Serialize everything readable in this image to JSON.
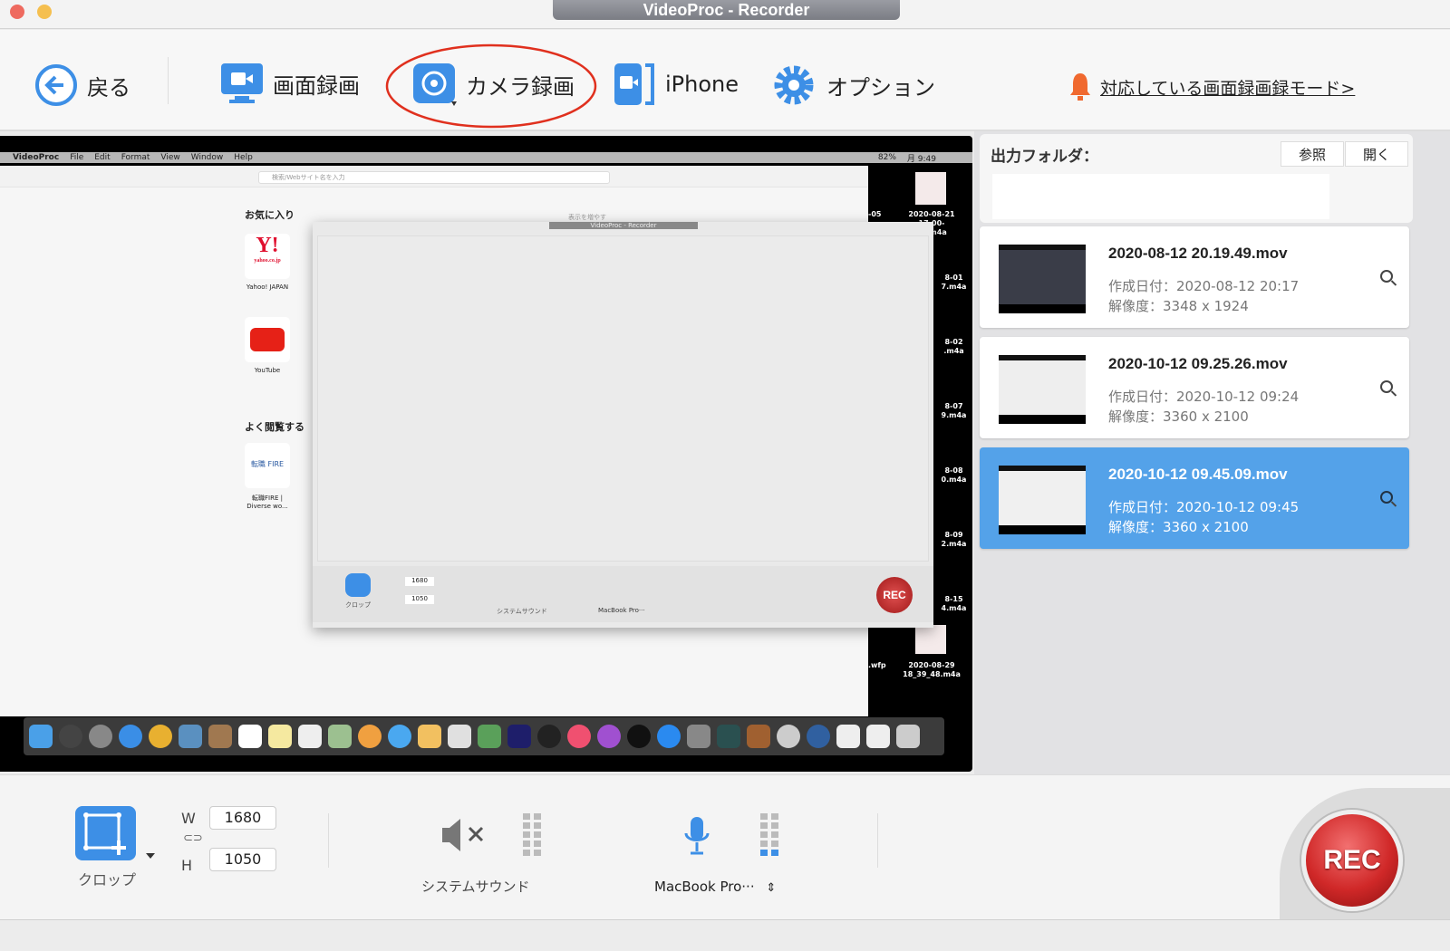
{
  "window": {
    "title": "VideoProc - Recorder"
  },
  "toolbar": {
    "back": "戻る",
    "screen_record": "画面録画",
    "camera_record": "カメラ録画",
    "iphone": "iPhone",
    "options": "オプション",
    "supported_modes_link": "対応している画面録画録モード>"
  },
  "colors": {
    "accent": "#3d8fe6",
    "selected": "#54a2e9",
    "rec": "#d8302e",
    "bell": "#f0692f",
    "annotation_circle": "#e0301e"
  },
  "preview": {
    "menubar": {
      "apple": "",
      "app": "VideoProc",
      "items": [
        "File",
        "Edit",
        "Format",
        "View",
        "Window",
        "Help"
      ],
      "battery": "82%",
      "clock": "月 9:49"
    },
    "safari": {
      "search_placeholder": "検索/Webサイト名を入力",
      "favorites": "お気に入り",
      "show_more": "表示を増やす",
      "frequent": "よく閲覧する",
      "tiles": [
        {
          "label": "Yahoo! JAPAN",
          "logo": "Y!",
          "sub": "yahoo.co.jp"
        },
        {
          "label": "YouTube"
        },
        {
          "label": "転職FIRE | Diverse wo...",
          "logo": "転職 FIRE"
        }
      ]
    },
    "inner_recorder": {
      "title": "VideoProc - Recorder",
      "crop": "クロップ",
      "w": "1680",
      "h": "1050",
      "system_sound": "システムサウンド",
      "mic": "MacBook Pro···",
      "rec": "REC"
    },
    "desktop_files": [
      "-05",
      "2020-08-21 17-00-55.m4a",
      "8-01 7.m4a",
      "8-02 .m4a",
      "8-07 9.m4a",
      "8-08 0.m4a",
      "8-09 2.m4a",
      "8-15 4.m4a",
      ".wfp",
      "2020-08-29 18_39_48.m4a"
    ]
  },
  "output": {
    "label": "出力フォルダ：",
    "browse": "参照",
    "open": "開く",
    "path": ""
  },
  "recordings": [
    {
      "name": "2020-08-12 20.19.49.mov",
      "created": "作成日付：2020-08-12 20:17",
      "resolution": "解像度：3348 x 1924",
      "selected": false
    },
    {
      "name": "2020-10-12 09.25.26.mov",
      "created": "作成日付：2020-10-12 09:24",
      "resolution": "解像度：3360 x 2100",
      "selected": false
    },
    {
      "name": "2020-10-12 09.45.09.mov",
      "created": "作成日付：2020-10-12 09:45",
      "resolution": "解像度：3360 x 2100",
      "selected": true
    }
  ],
  "controls": {
    "crop": "クロップ",
    "w_label": "W",
    "h_label": "H",
    "width": "1680",
    "height": "1050",
    "system_sound": "システムサウンド",
    "mic": "MacBook Pro···",
    "rec": "REC",
    "mic_level": 0.1,
    "system_level": 0
  }
}
